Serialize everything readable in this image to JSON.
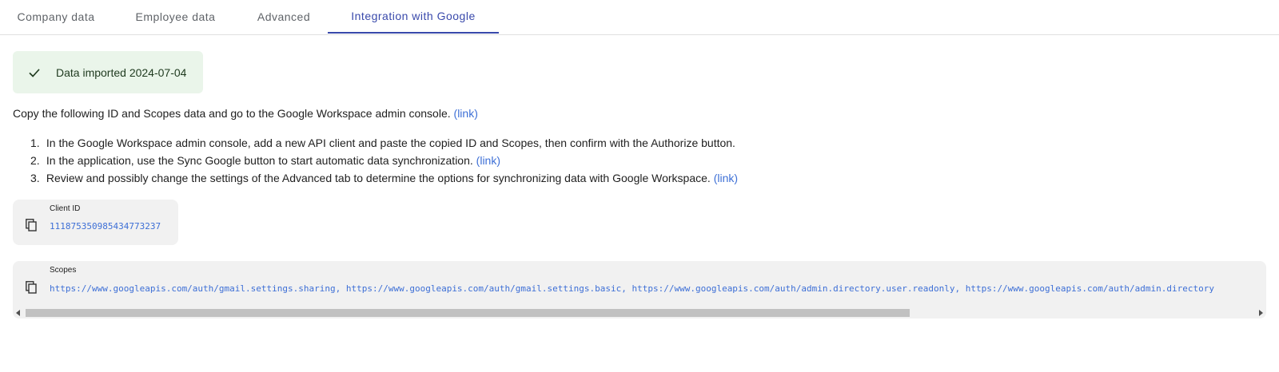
{
  "tabs": [
    {
      "label": "Company data",
      "active": false
    },
    {
      "label": "Employee data",
      "active": false
    },
    {
      "label": "Advanced",
      "active": false
    },
    {
      "label": "Integration with Google",
      "active": true
    }
  ],
  "banner": {
    "icon": "check-icon",
    "text": "Data imported 2024-07-04",
    "bg_color": "#eaf5ea"
  },
  "intro": {
    "text": "Copy the following ID and Scopes data and go to the Google Workspace admin console.",
    "link": "(link)"
  },
  "steps": [
    {
      "num": "1.",
      "text": "In the Google Workspace admin console, add a new API client and paste the copied ID and Scopes, then confirm with the Authorize button.",
      "link": ""
    },
    {
      "num": "2.",
      "text": "In the application, use the Sync Google button to start automatic data synchronization.",
      "link": "(link)"
    },
    {
      "num": "3.",
      "text": "Review and possibly change the settings of the Advanced tab to determine the options for synchronizing data with Google Workspace.",
      "link": "(link)"
    }
  ],
  "client": {
    "label": "Client ID",
    "value": "111875350985434773237",
    "icon": "copy-icon"
  },
  "scopes": {
    "label": "Scopes",
    "value": "https://www.googleapis.com/auth/gmail.settings.sharing, https://www.googleapis.com/auth/gmail.settings.basic, https://www.googleapis.com/auth/admin.directory.user.readonly, https://www.googleapis.com/auth/admin.directory",
    "icon": "copy-icon",
    "scroll_fraction": 0.72
  },
  "colors": {
    "accent": "#3949ab",
    "link": "#3d6fd6",
    "card_bg": "#f1f1f1"
  }
}
